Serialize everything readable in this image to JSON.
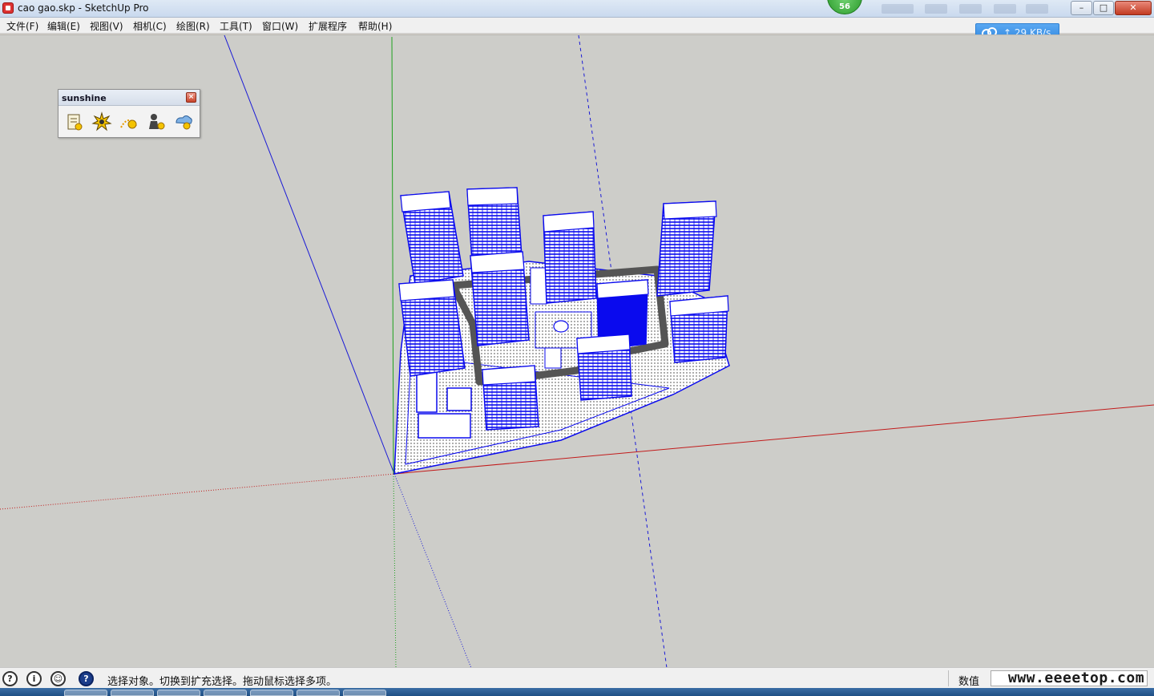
{
  "window": {
    "title": "cao gao.skp - SketchUp Pro",
    "badge_count": "56",
    "buttons": {
      "minimize": "–",
      "maximize": "□",
      "close": "✕"
    }
  },
  "menu": {
    "items": [
      "文件(F)",
      "编辑(E)",
      "视图(V)",
      "相机(C)",
      "绘图(R)",
      "工具(T)",
      "窗口(W)",
      "扩展程序",
      "帮助(H)"
    ]
  },
  "speed_widget": {
    "text": "29 KB/s"
  },
  "toolbox": {
    "title": "sunshine",
    "close": "×",
    "tools": [
      "sun-settings-icon",
      "sun-burst-icon",
      "sun-path-icon",
      "sun-figure-icon",
      "sun-cloud-icon"
    ]
  },
  "status": {
    "message": "选择对象。切换到扩充选择。拖动鼠标选择多项。",
    "value_label": "数值",
    "icons": [
      "geo-location-icon",
      "info-icon",
      "user-icon",
      "help-icon"
    ],
    "icon_glyphs": [
      "?",
      "i",
      "☺",
      "?"
    ]
  },
  "watermark": "www.eeeetop.com",
  "colors": {
    "axis_red": "#c21b1b",
    "axis_green": "#1ea11e",
    "axis_blue": "#1a1ad6",
    "model_blue": "#0a0aee",
    "viewport_bg": "#cdcdc9"
  }
}
